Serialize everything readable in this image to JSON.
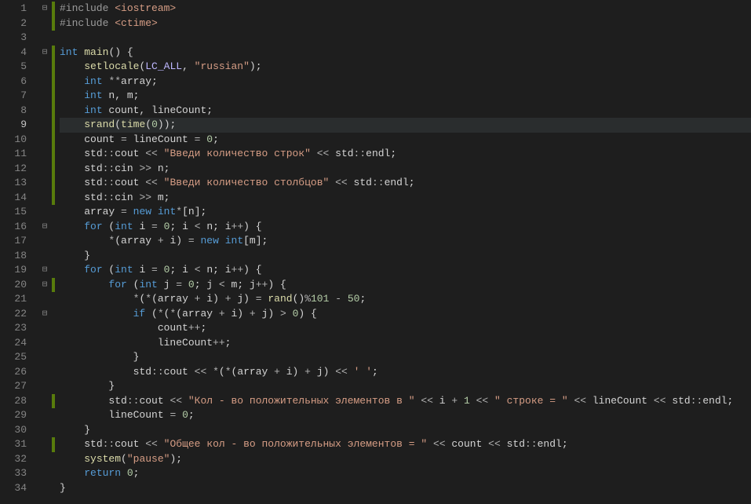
{
  "lineNumbers": [
    "1",
    "2",
    "3",
    "4",
    "5",
    "6",
    "7",
    "8",
    "9",
    "10",
    "11",
    "12",
    "13",
    "14",
    "15",
    "16",
    "17",
    "18",
    "19",
    "20",
    "21",
    "22",
    "23",
    "24",
    "25",
    "26",
    "27",
    "28",
    "29",
    "30",
    "31",
    "32",
    "33",
    "34"
  ],
  "activeLine": "9",
  "foldMarkers": {
    "l1": "⊟",
    "l4": "⊟",
    "l16": "⊟",
    "l19": "⊟",
    "l20": "⊟",
    "l22": "⊟"
  },
  "changedLines": [
    1,
    2,
    4,
    5,
    6,
    7,
    8,
    9,
    10,
    11,
    12,
    13,
    14,
    20,
    28,
    31
  ],
  "code": {
    "l1": {
      "indent": "",
      "tokens": [
        [
          "pp",
          "#include "
        ],
        [
          "hdr",
          "<iostream>"
        ]
      ]
    },
    "l2": {
      "indent": "",
      "tokens": [
        [
          "pp",
          "#include "
        ],
        [
          "hdr",
          "<ctime>"
        ]
      ]
    },
    "l3": {
      "indent": "",
      "tokens": []
    },
    "l4": {
      "indent": "",
      "tokens": [
        [
          "kw",
          "int"
        ],
        [
          "id",
          " "
        ],
        [
          "fn",
          "main"
        ],
        [
          "punct",
          "() {"
        ]
      ]
    },
    "l5": {
      "indent": "    ",
      "tokens": [
        [
          "fn",
          "setlocale"
        ],
        [
          "punct",
          "("
        ],
        [
          "macro",
          "LC_ALL"
        ],
        [
          "punct",
          ", "
        ],
        [
          "str",
          "\"russian\""
        ],
        [
          "punct",
          ");"
        ]
      ]
    },
    "l6": {
      "indent": "    ",
      "tokens": [
        [
          "kw",
          "int"
        ],
        [
          "id",
          " "
        ],
        [
          "op",
          "**"
        ],
        [
          "id",
          "array;"
        ]
      ]
    },
    "l7": {
      "indent": "    ",
      "tokens": [
        [
          "kw",
          "int"
        ],
        [
          "id",
          " n, m;"
        ]
      ]
    },
    "l8": {
      "indent": "    ",
      "tokens": [
        [
          "kw",
          "int"
        ],
        [
          "id",
          " count, lineCount;"
        ]
      ]
    },
    "l9": {
      "indent": "    ",
      "tokens": [
        [
          "fn",
          "srand"
        ],
        [
          "punct",
          "("
        ],
        [
          "fn",
          "time"
        ],
        [
          "punct",
          "("
        ],
        [
          "num",
          "0"
        ],
        [
          "punct",
          "));"
        ]
      ]
    },
    "l10": {
      "indent": "    ",
      "tokens": [
        [
          "id",
          "count "
        ],
        [
          "op",
          "="
        ],
        [
          "id",
          " lineCount "
        ],
        [
          "op",
          "="
        ],
        [
          "id",
          " "
        ],
        [
          "num",
          "0"
        ],
        [
          "punct",
          ";"
        ]
      ]
    },
    "l11": {
      "indent": "    ",
      "tokens": [
        [
          "ns",
          "std"
        ],
        [
          "op",
          "::"
        ],
        [
          "id",
          "cout "
        ],
        [
          "op",
          "<<"
        ],
        [
          "id",
          " "
        ],
        [
          "str",
          "\"Введи количество строк\""
        ],
        [
          "id",
          " "
        ],
        [
          "op",
          "<<"
        ],
        [
          "id",
          " "
        ],
        [
          "ns",
          "std"
        ],
        [
          "op",
          "::"
        ],
        [
          "id",
          "endl;"
        ]
      ]
    },
    "l12": {
      "indent": "    ",
      "tokens": [
        [
          "ns",
          "std"
        ],
        [
          "op",
          "::"
        ],
        [
          "id",
          "cin "
        ],
        [
          "op",
          ">>"
        ],
        [
          "id",
          " n;"
        ]
      ]
    },
    "l13": {
      "indent": "    ",
      "tokens": [
        [
          "ns",
          "std"
        ],
        [
          "op",
          "::"
        ],
        [
          "id",
          "cout "
        ],
        [
          "op",
          "<<"
        ],
        [
          "id",
          " "
        ],
        [
          "str",
          "\"Введи количество столбцов\""
        ],
        [
          "id",
          " "
        ],
        [
          "op",
          "<<"
        ],
        [
          "id",
          " "
        ],
        [
          "ns",
          "std"
        ],
        [
          "op",
          "::"
        ],
        [
          "id",
          "endl;"
        ]
      ]
    },
    "l14": {
      "indent": "    ",
      "tokens": [
        [
          "ns",
          "std"
        ],
        [
          "op",
          "::"
        ],
        [
          "id",
          "cin "
        ],
        [
          "op",
          ">>"
        ],
        [
          "id",
          " m;"
        ]
      ]
    },
    "l15": {
      "indent": "    ",
      "tokens": [
        [
          "id",
          "array "
        ],
        [
          "op",
          "="
        ],
        [
          "id",
          " "
        ],
        [
          "kw",
          "new"
        ],
        [
          "id",
          " "
        ],
        [
          "kw",
          "int"
        ],
        [
          "op",
          "*"
        ],
        [
          "punct",
          "[n];"
        ]
      ]
    },
    "l16": {
      "indent": "    ",
      "tokens": [
        [
          "kw",
          "for"
        ],
        [
          "punct",
          " ("
        ],
        [
          "kw",
          "int"
        ],
        [
          "id",
          " i "
        ],
        [
          "op",
          "="
        ],
        [
          "id",
          " "
        ],
        [
          "num",
          "0"
        ],
        [
          "punct",
          "; i "
        ],
        [
          "op",
          "<"
        ],
        [
          "punct",
          " n; i"
        ],
        [
          "op",
          "++"
        ],
        [
          "punct",
          ") {"
        ]
      ]
    },
    "l17": {
      "indent": "        ",
      "tokens": [
        [
          "op",
          "*"
        ],
        [
          "punct",
          "(array "
        ],
        [
          "op",
          "+"
        ],
        [
          "punct",
          " i) "
        ],
        [
          "op",
          "="
        ],
        [
          "id",
          " "
        ],
        [
          "kw",
          "new"
        ],
        [
          "id",
          " "
        ],
        [
          "kw",
          "int"
        ],
        [
          "punct",
          "[m];"
        ]
      ]
    },
    "l18": {
      "indent": "    ",
      "tokens": [
        [
          "punct",
          "}"
        ]
      ]
    },
    "l19": {
      "indent": "    ",
      "tokens": [
        [
          "kw",
          "for"
        ],
        [
          "punct",
          " ("
        ],
        [
          "kw",
          "int"
        ],
        [
          "id",
          " i "
        ],
        [
          "op",
          "="
        ],
        [
          "id",
          " "
        ],
        [
          "num",
          "0"
        ],
        [
          "punct",
          "; i "
        ],
        [
          "op",
          "<"
        ],
        [
          "punct",
          " n; i"
        ],
        [
          "op",
          "++"
        ],
        [
          "punct",
          ") {"
        ]
      ]
    },
    "l20": {
      "indent": "        ",
      "tokens": [
        [
          "kw",
          "for"
        ],
        [
          "punct",
          " ("
        ],
        [
          "kw",
          "int"
        ],
        [
          "id",
          " j "
        ],
        [
          "op",
          "="
        ],
        [
          "id",
          " "
        ],
        [
          "num",
          "0"
        ],
        [
          "punct",
          "; j "
        ],
        [
          "op",
          "<"
        ],
        [
          "punct",
          " m; j"
        ],
        [
          "op",
          "++"
        ],
        [
          "punct",
          ") {"
        ]
      ]
    },
    "l21": {
      "indent": "            ",
      "tokens": [
        [
          "op",
          "*"
        ],
        [
          "punct",
          "("
        ],
        [
          "op",
          "*"
        ],
        [
          "punct",
          "(array "
        ],
        [
          "op",
          "+"
        ],
        [
          "punct",
          " i) "
        ],
        [
          "op",
          "+"
        ],
        [
          "punct",
          " j) "
        ],
        [
          "op",
          "="
        ],
        [
          "id",
          " "
        ],
        [
          "fn",
          "rand"
        ],
        [
          "punct",
          "()"
        ],
        [
          "op",
          "%"
        ],
        [
          "num",
          "101"
        ],
        [
          "id",
          " "
        ],
        [
          "op",
          "-"
        ],
        [
          "id",
          " "
        ],
        [
          "num",
          "50"
        ],
        [
          "punct",
          ";"
        ]
      ]
    },
    "l22": {
      "indent": "            ",
      "tokens": [
        [
          "kw",
          "if"
        ],
        [
          "punct",
          " ("
        ],
        [
          "op",
          "*"
        ],
        [
          "punct",
          "("
        ],
        [
          "op",
          "*"
        ],
        [
          "punct",
          "(array "
        ],
        [
          "op",
          "+"
        ],
        [
          "punct",
          " i) "
        ],
        [
          "op",
          "+"
        ],
        [
          "punct",
          " j) "
        ],
        [
          "op",
          ">"
        ],
        [
          "id",
          " "
        ],
        [
          "num",
          "0"
        ],
        [
          "punct",
          ") {"
        ]
      ]
    },
    "l23": {
      "indent": "                ",
      "tokens": [
        [
          "id",
          "count"
        ],
        [
          "op",
          "++"
        ],
        [
          "punct",
          ";"
        ]
      ]
    },
    "l24": {
      "indent": "                ",
      "tokens": [
        [
          "id",
          "lineCount"
        ],
        [
          "op",
          "++"
        ],
        [
          "punct",
          ";"
        ]
      ]
    },
    "l25": {
      "indent": "            ",
      "tokens": [
        [
          "punct",
          "}"
        ]
      ]
    },
    "l26": {
      "indent": "            ",
      "tokens": [
        [
          "ns",
          "std"
        ],
        [
          "op",
          "::"
        ],
        [
          "id",
          "cout "
        ],
        [
          "op",
          "<<"
        ],
        [
          "id",
          " "
        ],
        [
          "op",
          "*"
        ],
        [
          "punct",
          "("
        ],
        [
          "op",
          "*"
        ],
        [
          "punct",
          "(array "
        ],
        [
          "op",
          "+"
        ],
        [
          "punct",
          " i) "
        ],
        [
          "op",
          "+"
        ],
        [
          "punct",
          " j) "
        ],
        [
          "op",
          "<<"
        ],
        [
          "id",
          " "
        ],
        [
          "ch",
          "' '"
        ],
        [
          "punct",
          ";"
        ]
      ]
    },
    "l27": {
      "indent": "        ",
      "tokens": [
        [
          "punct",
          "}"
        ]
      ]
    },
    "l28": {
      "indent": "        ",
      "tokens": [
        [
          "ns",
          "std"
        ],
        [
          "op",
          "::"
        ],
        [
          "id",
          "cout "
        ],
        [
          "op",
          "<<"
        ],
        [
          "id",
          " "
        ],
        [
          "str",
          "\"Кол - во положительных элементов в \""
        ],
        [
          "id",
          " "
        ],
        [
          "op",
          "<<"
        ],
        [
          "id",
          " i "
        ],
        [
          "op",
          "+"
        ],
        [
          "id",
          " "
        ],
        [
          "num",
          "1"
        ],
        [
          "id",
          " "
        ],
        [
          "op",
          "<<"
        ],
        [
          "id",
          " "
        ],
        [
          "str",
          "\" строке = \""
        ],
        [
          "id",
          " "
        ],
        [
          "op",
          "<<"
        ],
        [
          "id",
          " lineCount "
        ],
        [
          "op",
          "<<"
        ],
        [
          "id",
          " "
        ],
        [
          "ns",
          "std"
        ],
        [
          "op",
          "::"
        ],
        [
          "id",
          "endl;"
        ]
      ]
    },
    "l29": {
      "indent": "        ",
      "tokens": [
        [
          "id",
          "lineCount "
        ],
        [
          "op",
          "="
        ],
        [
          "id",
          " "
        ],
        [
          "num",
          "0"
        ],
        [
          "punct",
          ";"
        ]
      ]
    },
    "l30": {
      "indent": "    ",
      "tokens": [
        [
          "punct",
          "}"
        ]
      ]
    },
    "l31": {
      "indent": "    ",
      "tokens": [
        [
          "ns",
          "std"
        ],
        [
          "op",
          "::"
        ],
        [
          "id",
          "cout "
        ],
        [
          "op",
          "<<"
        ],
        [
          "id",
          " "
        ],
        [
          "str",
          "\"Общее кол - во положительных элементов = \""
        ],
        [
          "id",
          " "
        ],
        [
          "op",
          "<<"
        ],
        [
          "id",
          " count "
        ],
        [
          "op",
          "<<"
        ],
        [
          "id",
          " "
        ],
        [
          "ns",
          "std"
        ],
        [
          "op",
          "::"
        ],
        [
          "id",
          "endl;"
        ]
      ]
    },
    "l32": {
      "indent": "    ",
      "tokens": [
        [
          "fn",
          "system"
        ],
        [
          "punct",
          "("
        ],
        [
          "str",
          "\"pause\""
        ],
        [
          "punct",
          ");"
        ]
      ]
    },
    "l33": {
      "indent": "    ",
      "tokens": [
        [
          "kw",
          "return"
        ],
        [
          "id",
          " "
        ],
        [
          "num",
          "0"
        ],
        [
          "punct",
          ";"
        ]
      ]
    },
    "l34": {
      "indent": "",
      "tokens": [
        [
          "punct",
          "}"
        ]
      ]
    }
  }
}
